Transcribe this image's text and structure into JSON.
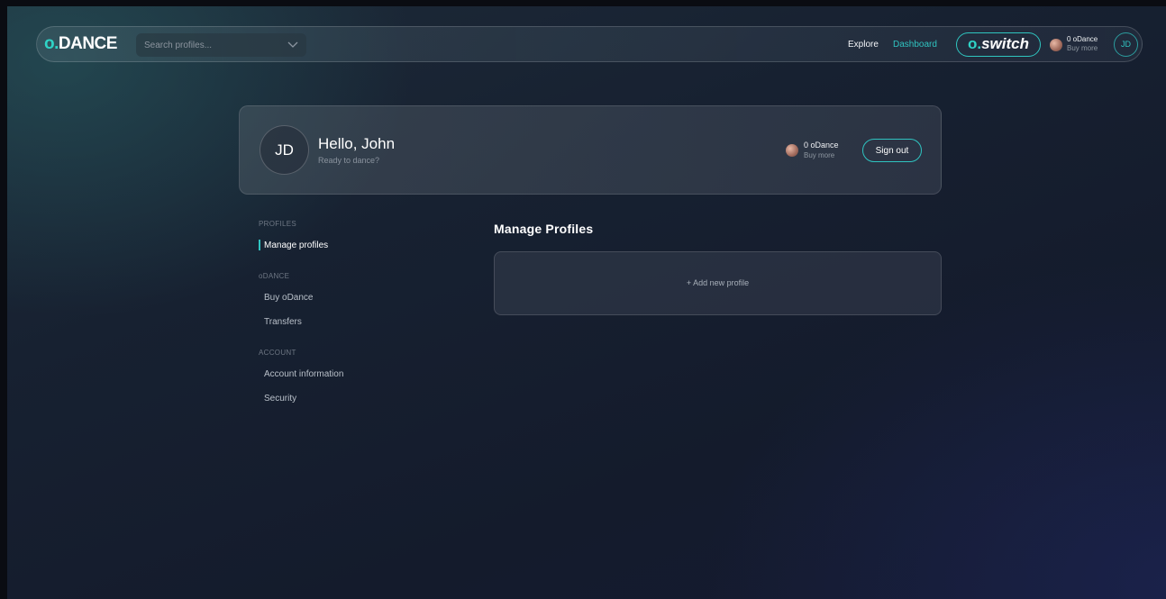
{
  "navbar": {
    "logo_dot": "o.",
    "logo_text": "DANCE",
    "search_placeholder": "Search profiles...",
    "links": {
      "explore": "Explore",
      "dashboard": "Dashboard"
    },
    "switch": {
      "dot": "o.",
      "text": "switch"
    },
    "balance": {
      "amount": "0 oDance",
      "buy": "Buy more"
    },
    "avatar_initials": "JD"
  },
  "profile_card": {
    "initials": "JD",
    "greeting": "Hello, John",
    "subtitle": "Ready to dance?",
    "balance": {
      "amount": "0 oDance",
      "buy": "Buy more"
    },
    "sign_out": "Sign out"
  },
  "sidebar": {
    "sections": [
      {
        "heading": "PROFILES",
        "items": [
          {
            "label": "Manage profiles",
            "active": true
          }
        ]
      },
      {
        "heading": "oDANCE",
        "items": [
          {
            "label": "Buy oDance"
          },
          {
            "label": "Transfers"
          }
        ]
      },
      {
        "heading": "ACCOUNT",
        "items": [
          {
            "label": "Account information"
          },
          {
            "label": "Security"
          }
        ]
      }
    ]
  },
  "main": {
    "title": "Manage Profiles",
    "add_profile": "+ Add new profile"
  },
  "colors": {
    "accent": "#2fc3c0",
    "background": "#151b2c",
    "card": "#4b5562"
  },
  "icons": {
    "search_dropdown": "chevron-down-icon",
    "coin": "coin-icon"
  }
}
